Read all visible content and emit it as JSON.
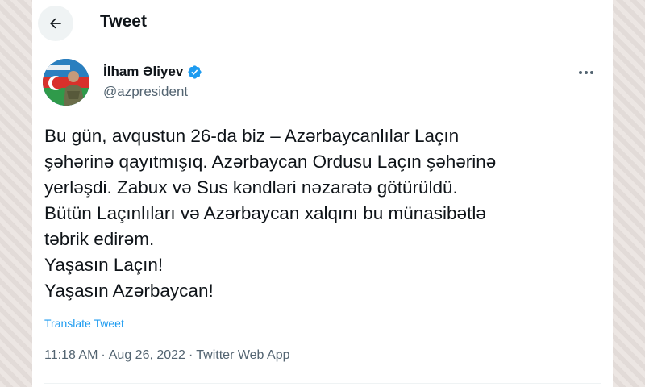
{
  "header": {
    "back_icon": "arrow-left-icon",
    "title": "Tweet"
  },
  "author": {
    "name": "İlham Əliyev",
    "verified_icon": "verified-badge-icon",
    "handle": "@azpresident"
  },
  "tweet": {
    "lines": [
      "Bu gün, avqustun 26-da biz – Azərbaycanlılar Laçın",
      "şəhərinə qayıtmışıq. Azərbaycan Ordusu Laçın şəhərinə",
      "yerləşdi. Zabux və Sus kəndləri nəzarətə götürüldü.",
      "Bütün Laçınlıları və Azərbaycan xalqını bu münasibətlə",
      "təbrik edirəm.",
      "Yaşasın Laçın!",
      "Yaşasın Azərbaycan!"
    ],
    "translate_label": "Translate Tweet",
    "time": "11:18 AM",
    "date": "Aug 26, 2022",
    "source": "Twitter Web App",
    "separator": "·"
  },
  "colors": {
    "text": "#0f1419",
    "secondary": "#536471",
    "link": "#1d9bf0",
    "verified": "#1d9bf0"
  }
}
